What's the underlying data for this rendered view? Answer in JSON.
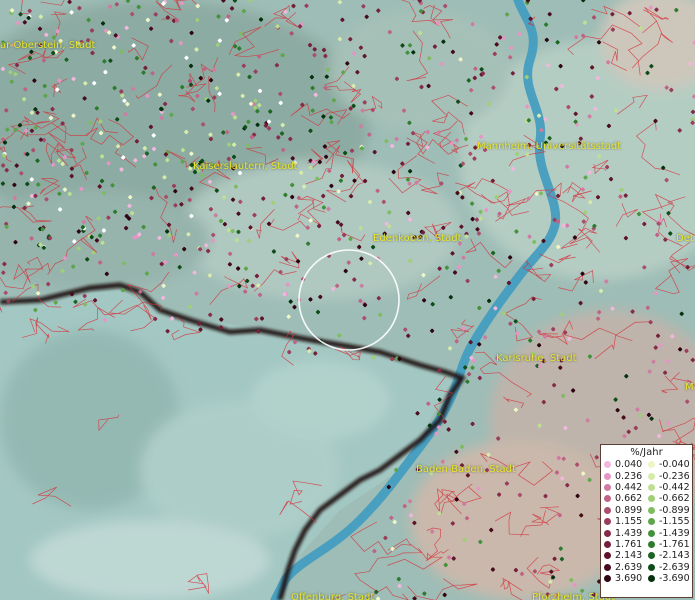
{
  "map": {
    "cities": [
      {
        "name": "ar-Oberstein, Stadt"
      },
      {
        "name": "Kaiserslautern, Stadt"
      },
      {
        "name": "Mannheim, Universitätsstadt"
      },
      {
        "name": "Edenkoben, Stadt"
      },
      {
        "name": "Det"
      },
      {
        "name": "Karlsruhe, Stadt"
      },
      {
        "name": "M"
      },
      {
        "name": "Baden-Baden, Stadt"
      },
      {
        "name": "Offenburg, Stadt"
      },
      {
        "name": "Pforzheim, Stadt"
      }
    ]
  },
  "legend": {
    "title": "%/Jahr",
    "positive": [
      {
        "label": "0.040",
        "color": "#f2b7dc"
      },
      {
        "label": "0.236",
        "color": "#e696c6"
      },
      {
        "label": "0.442",
        "color": "#cf7ca2"
      },
      {
        "label": "0.662",
        "color": "#bf6487"
      },
      {
        "label": "0.899",
        "color": "#ab4f6e"
      },
      {
        "label": "1.155",
        "color": "#9a3e5a"
      },
      {
        "label": "1.439",
        "color": "#872c48"
      },
      {
        "label": "1.761",
        "color": "#742038"
      },
      {
        "label": "2.143",
        "color": "#5f1429"
      },
      {
        "label": "2.639",
        "color": "#480b1c"
      },
      {
        "label": "3.690",
        "color": "#2e0510"
      }
    ],
    "negative": [
      {
        "label": "-0.040",
        "color": "#eef5c6"
      },
      {
        "label": "-0.236",
        "color": "#d7ecaa"
      },
      {
        "label": "-0.442",
        "color": "#bfe092"
      },
      {
        "label": "-0.662",
        "color": "#9fcf77"
      },
      {
        "label": "-0.899",
        "color": "#7fbc5f"
      },
      {
        "label": "-1.155",
        "color": "#5ea64b"
      },
      {
        "label": "-1.439",
        "color": "#43913a"
      },
      {
        "label": "-1.761",
        "color": "#2d7b2d"
      },
      {
        "label": "-2.143",
        "color": "#1b6422"
      },
      {
        "label": "-2.639",
        "color": "#0e4c18"
      },
      {
        "label": "-3.690",
        "color": "#043010"
      }
    ]
  }
}
